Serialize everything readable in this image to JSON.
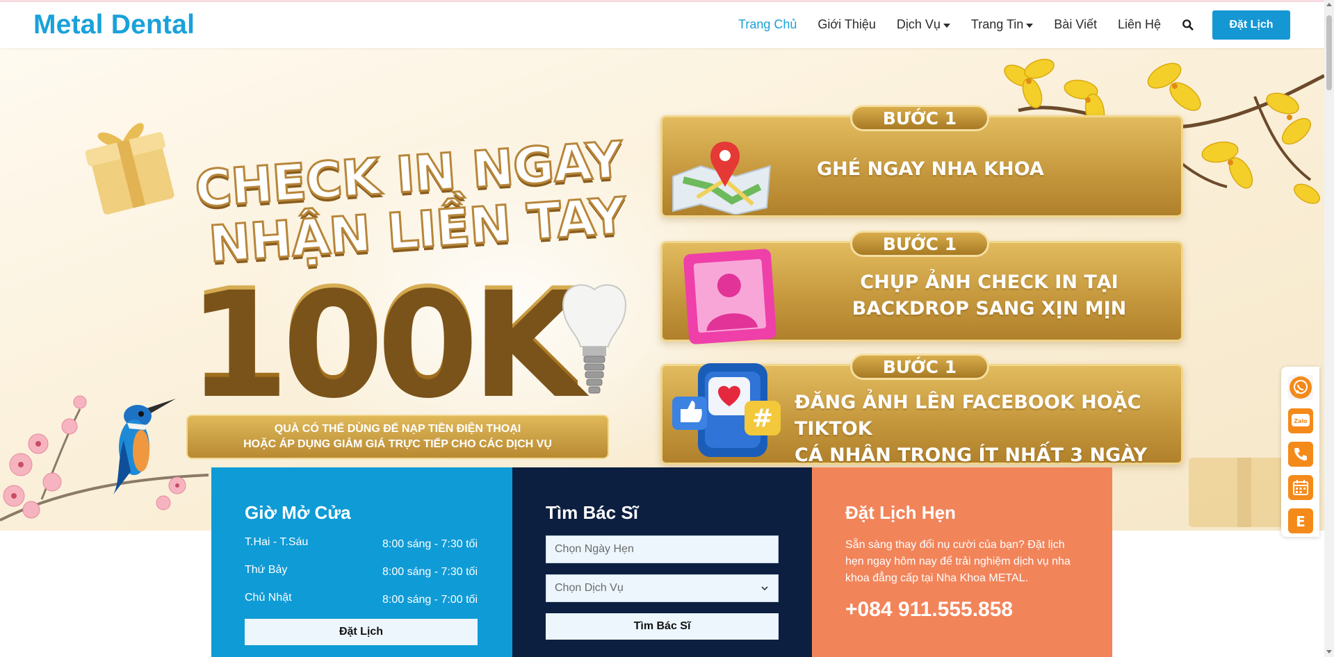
{
  "brand": {
    "name": "Metal Dental",
    "color": "#1aa1da"
  },
  "nav": {
    "items": [
      {
        "label": "Trang Chủ",
        "active": true,
        "dropdown": false
      },
      {
        "label": "Giới Thiệu",
        "active": false,
        "dropdown": false
      },
      {
        "label": "Dịch Vụ",
        "active": false,
        "dropdown": true
      },
      {
        "label": "Trang Tin",
        "active": false,
        "dropdown": true
      },
      {
        "label": "Bài Viết",
        "active": false,
        "dropdown": false
      },
      {
        "label": "Liên Hệ",
        "active": false,
        "dropdown": false
      }
    ],
    "search_icon": "search-icon",
    "book_label": "Đặt Lịch"
  },
  "hero": {
    "headline_line1": "CHECK IN NGAY",
    "headline_line2": "NHẬN LIỀN TAY",
    "amount": "100K",
    "gift_line1": "QUÀ CÓ THỂ DÙNG ĐỂ NẠP TIỀN ĐIỆN THOẠI",
    "gift_line2": "HOẶC ÁP DỤNG GIẢM GIÁ TRỰC TIẾP CHO CÁC DỊCH VỤ",
    "steps": [
      {
        "tag": "BƯỚC 1",
        "line1": "GHÉ NGAY NHA KHOA",
        "line2": "",
        "icon": "map-pin-icon"
      },
      {
        "tag": "BƯỚC 1",
        "line1": "CHỤP ẢNH CHECK IN TẠI",
        "line2": "BACKDROP SANG XỊN MỊN",
        "icon": "photo-frame-icon"
      },
      {
        "tag": "BƯỚC 1",
        "line1": "ĐĂNG ẢNH LÊN FACEBOOK HOẶC TIKTOK",
        "line2": "CÁ NHÂN TRONG ÍT NHẤT 3 NGÀY",
        "icon": "social-media-icon"
      }
    ]
  },
  "hours": {
    "title": "Giờ Mở Cửa",
    "rows": [
      {
        "day": "T.Hai - T.Sáu",
        "time": "8:00 sáng - 7:30 tối"
      },
      {
        "day": "Thứ Bảy",
        "time": "8:00 sáng - 7:30 tối"
      },
      {
        "day": "Chủ Nhật",
        "time": "8:00 sáng - 7:00 tối"
      }
    ],
    "button": "Đặt Lịch"
  },
  "doctor": {
    "title": "Tìm Bác Sĩ",
    "date_placeholder": "Chọn Ngày Hẹn",
    "service_selected": "Chọn Dịch Vụ",
    "button": "Tìm Bác Sĩ"
  },
  "appointment": {
    "title": "Đặt Lịch Hẹn",
    "text": "Sẵn sàng thay đổi nụ cười của bạn? Đặt lịch hẹn ngay hôm nay để trải nghiệm dịch vụ nha khoa đẳng cấp tại Nha Khoa METAL.",
    "phone": "+084 911.555.858"
  },
  "float_contact": [
    {
      "icon": "whatsapp-icon"
    },
    {
      "icon": "zalo-icon",
      "label": "Zalo"
    },
    {
      "icon": "phone-icon"
    },
    {
      "icon": "calendar-icon"
    },
    {
      "icon": "email-icon",
      "label": "E"
    }
  ],
  "colors": {
    "accent": "#1597d4",
    "hours_bg": "#0f9bd6",
    "doctor_bg": "#0d1f40",
    "appointment_bg": "#f2845a",
    "gold": "#c4963c"
  }
}
